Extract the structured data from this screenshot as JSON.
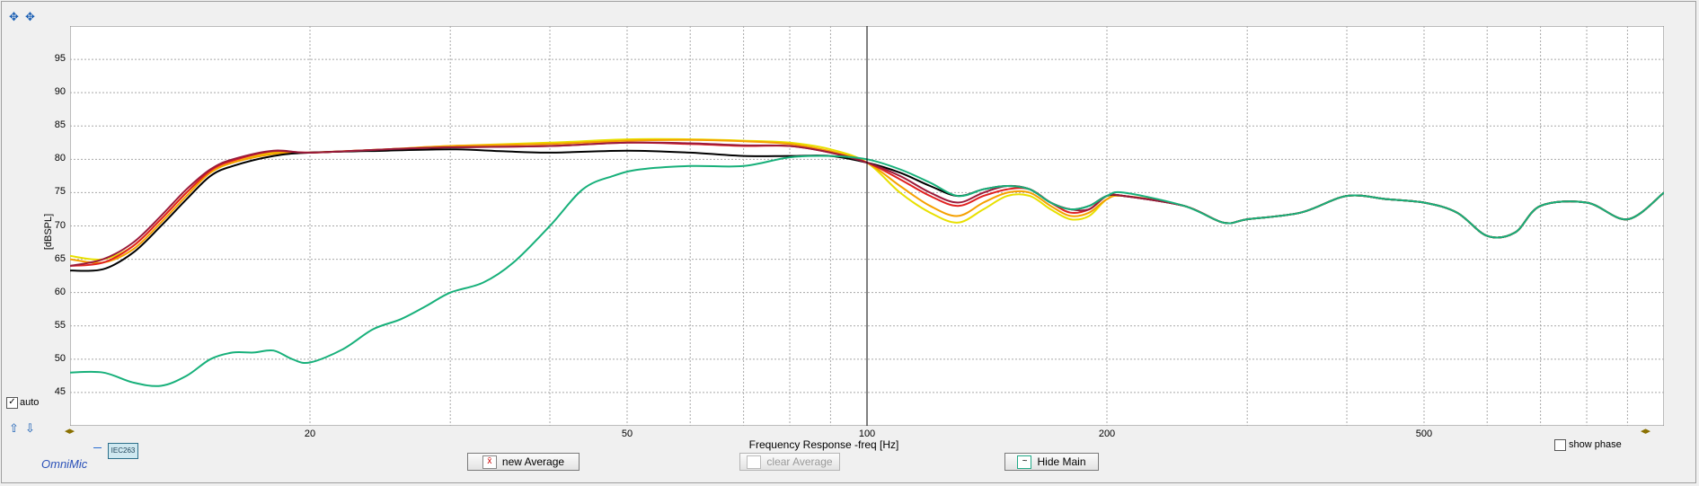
{
  "toolbar": {
    "top_icons": [
      "zoom-fit-icon",
      "zoom-all-icon"
    ],
    "bottom_icons": [
      "scroll-up-icon",
      "scroll-down-icon"
    ],
    "auto_label": "auto",
    "auto_checked": true
  },
  "chart_data": {
    "type": "line",
    "xlabel": "Frequency Response -freq [Hz]",
    "ylabel": "[dBSPL]",
    "xscale": "log",
    "xlim": [
      10,
      1000
    ],
    "ylim": [
      40,
      100
    ],
    "x_ticks": [
      "20",
      "50",
      "100",
      "200",
      "500"
    ],
    "y_ticks": [
      "45",
      "50",
      "55",
      "60",
      "65",
      "70",
      "75",
      "80",
      "85",
      "90",
      "95"
    ],
    "grid": true,
    "cursor_x": 100,
    "series": [
      {
        "color": "#e8e000",
        "points": [
          [
            10,
            65.5
          ],
          [
            11,
            65
          ],
          [
            12,
            67
          ],
          [
            13,
            71
          ],
          [
            14,
            75
          ],
          [
            15,
            78
          ],
          [
            16,
            79.5
          ],
          [
            18,
            81
          ],
          [
            20,
            81
          ],
          [
            25,
            81.5
          ],
          [
            30,
            82
          ],
          [
            40,
            82.5
          ],
          [
            50,
            83
          ],
          [
            60,
            83
          ],
          [
            70,
            82.8
          ],
          [
            80,
            82.5
          ],
          [
            90,
            81.5
          ],
          [
            100,
            79.5
          ],
          [
            110,
            75
          ],
          [
            120,
            72
          ],
          [
            130,
            70.5
          ],
          [
            140,
            72.5
          ],
          [
            150,
            74.5
          ],
          [
            160,
            74.5
          ],
          [
            170,
            72.5
          ],
          [
            180,
            71
          ],
          [
            190,
            71.5
          ],
          [
            200,
            74
          ],
          [
            210,
            74.5
          ],
          [
            250,
            73
          ],
          [
            280,
            70.5
          ],
          [
            300,
            71
          ],
          [
            350,
            72
          ],
          [
            400,
            74.5
          ],
          [
            450,
            74
          ],
          [
            500,
            73.5
          ],
          [
            550,
            72
          ],
          [
            600,
            68.5
          ],
          [
            650,
            69
          ],
          [
            700,
            73
          ],
          [
            800,
            73.5
          ],
          [
            900,
            71
          ],
          [
            1000,
            75
          ]
        ]
      },
      {
        "color": "#f5a000",
        "points": [
          [
            10,
            65
          ],
          [
            11,
            64.5
          ],
          [
            12,
            66.5
          ],
          [
            13,
            70.5
          ],
          [
            14,
            74.5
          ],
          [
            15,
            78
          ],
          [
            16,
            79.5
          ],
          [
            18,
            80.8
          ],
          [
            20,
            81
          ],
          [
            25,
            81.5
          ],
          [
            30,
            82
          ],
          [
            40,
            82.3
          ],
          [
            50,
            82.8
          ],
          [
            60,
            82.9
          ],
          [
            70,
            82.7
          ],
          [
            80,
            82.3
          ],
          [
            90,
            81.2
          ],
          [
            100,
            79.5
          ],
          [
            110,
            76
          ],
          [
            120,
            73
          ],
          [
            130,
            71.5
          ],
          [
            140,
            73.5
          ],
          [
            150,
            75
          ],
          [
            160,
            75
          ],
          [
            170,
            73
          ],
          [
            180,
            71.5
          ],
          [
            190,
            72
          ],
          [
            200,
            74
          ],
          [
            210,
            74.5
          ],
          [
            250,
            73
          ],
          [
            280,
            70.5
          ],
          [
            300,
            71
          ],
          [
            350,
            72
          ],
          [
            400,
            74.5
          ],
          [
            450,
            74
          ],
          [
            500,
            73.5
          ],
          [
            550,
            72
          ],
          [
            600,
            68.5
          ],
          [
            650,
            69
          ],
          [
            700,
            73
          ],
          [
            800,
            73.5
          ],
          [
            900,
            71
          ],
          [
            1000,
            75
          ]
        ]
      },
      {
        "color": "#e02020",
        "points": [
          [
            10,
            64
          ],
          [
            11,
            64.5
          ],
          [
            12,
            67
          ],
          [
            13,
            71
          ],
          [
            14,
            75
          ],
          [
            15,
            78.3
          ],
          [
            16,
            79.8
          ],
          [
            18,
            81.2
          ],
          [
            20,
            81
          ],
          [
            25,
            81.5
          ],
          [
            30,
            81.8
          ],
          [
            40,
            82
          ],
          [
            50,
            82.5
          ],
          [
            60,
            82.3
          ],
          [
            70,
            82
          ],
          [
            80,
            82
          ],
          [
            90,
            81
          ],
          [
            100,
            79.5
          ],
          [
            110,
            77
          ],
          [
            120,
            74.5
          ],
          [
            130,
            73
          ],
          [
            140,
            74.5
          ],
          [
            150,
            75.5
          ],
          [
            160,
            75.5
          ],
          [
            170,
            73.5
          ],
          [
            180,
            72
          ],
          [
            190,
            72.5
          ],
          [
            200,
            74.5
          ],
          [
            210,
            74.5
          ],
          [
            250,
            73
          ],
          [
            280,
            70.5
          ],
          [
            300,
            71
          ],
          [
            350,
            72
          ],
          [
            400,
            74.5
          ],
          [
            450,
            74
          ],
          [
            500,
            73.5
          ],
          [
            550,
            72
          ],
          [
            600,
            68.5
          ],
          [
            650,
            69
          ],
          [
            700,
            73
          ],
          [
            800,
            73.5
          ],
          [
            900,
            71
          ],
          [
            1000,
            75
          ]
        ]
      },
      {
        "color": "#000000",
        "points": [
          [
            10,
            63.3
          ],
          [
            11,
            63.5
          ],
          [
            12,
            66
          ],
          [
            13,
            70
          ],
          [
            14,
            74
          ],
          [
            15,
            77.5
          ],
          [
            16,
            79
          ],
          [
            18,
            80.5
          ],
          [
            20,
            81
          ],
          [
            25,
            81.3
          ],
          [
            30,
            81.5
          ],
          [
            35,
            81.2
          ],
          [
            40,
            81
          ],
          [
            50,
            81.3
          ],
          [
            60,
            81
          ],
          [
            70,
            80.5
          ],
          [
            80,
            80.5
          ],
          [
            90,
            80.5
          ],
          [
            100,
            79.5
          ],
          [
            110,
            78
          ],
          [
            120,
            76
          ],
          [
            130,
            74.5
          ],
          [
            140,
            75.5
          ],
          [
            150,
            76
          ],
          [
            160,
            75.5
          ],
          [
            170,
            73.5
          ],
          [
            180,
            72.5
          ],
          [
            190,
            73
          ],
          [
            200,
            74.5
          ],
          [
            210,
            74.5
          ],
          [
            250,
            73
          ],
          [
            280,
            70.5
          ],
          [
            300,
            71
          ],
          [
            350,
            72
          ],
          [
            400,
            74.5
          ],
          [
            450,
            74
          ],
          [
            500,
            73.5
          ],
          [
            550,
            72
          ],
          [
            600,
            68.5
          ],
          [
            650,
            69
          ],
          [
            700,
            73
          ],
          [
            800,
            73.5
          ],
          [
            900,
            71
          ],
          [
            1000,
            75
          ]
        ]
      },
      {
        "color": "#9b1a3a",
        "points": [
          [
            10,
            64
          ],
          [
            11,
            65
          ],
          [
            12,
            67.5
          ],
          [
            13,
            71.5
          ],
          [
            14,
            75.5
          ],
          [
            15,
            78.5
          ],
          [
            16,
            80
          ],
          [
            18,
            81.3
          ],
          [
            20,
            81
          ],
          [
            25,
            81.5
          ],
          [
            30,
            81.8
          ],
          [
            40,
            82
          ],
          [
            50,
            82.5
          ],
          [
            60,
            82.4
          ],
          [
            70,
            82.1
          ],
          [
            80,
            82
          ],
          [
            90,
            81
          ],
          [
            100,
            79.5
          ],
          [
            110,
            77.5
          ],
          [
            120,
            75
          ],
          [
            130,
            73.5
          ],
          [
            140,
            75
          ],
          [
            150,
            76
          ],
          [
            160,
            75.5
          ],
          [
            170,
            73.5
          ],
          [
            180,
            72.5
          ],
          [
            190,
            72.5
          ],
          [
            200,
            74.5
          ],
          [
            210,
            74.5
          ],
          [
            250,
            73
          ],
          [
            280,
            70.5
          ],
          [
            300,
            71
          ],
          [
            350,
            72
          ],
          [
            400,
            74.5
          ],
          [
            450,
            74
          ],
          [
            500,
            73.5
          ],
          [
            550,
            72
          ],
          [
            600,
            68.5
          ],
          [
            650,
            69
          ],
          [
            700,
            73
          ],
          [
            800,
            73.5
          ],
          [
            900,
            71
          ],
          [
            1000,
            75
          ]
        ]
      },
      {
        "color": "#17b07a",
        "points": [
          [
            10,
            48
          ],
          [
            11,
            48
          ],
          [
            12,
            46.5
          ],
          [
            13,
            46
          ],
          [
            14,
            47.5
          ],
          [
            15,
            50
          ],
          [
            16,
            51
          ],
          [
            17,
            51
          ],
          [
            18,
            51.3
          ],
          [
            19,
            50
          ],
          [
            20,
            49.5
          ],
          [
            22,
            51.5
          ],
          [
            24,
            54.5
          ],
          [
            26,
            56
          ],
          [
            28,
            58
          ],
          [
            30,
            60
          ],
          [
            33,
            61.5
          ],
          [
            36,
            64.5
          ],
          [
            40,
            70
          ],
          [
            44,
            75.5
          ],
          [
            48,
            77.5
          ],
          [
            52,
            78.5
          ],
          [
            60,
            79
          ],
          [
            70,
            79
          ],
          [
            80,
            80.3
          ],
          [
            90,
            80.5
          ],
          [
            100,
            80
          ],
          [
            110,
            78.5
          ],
          [
            120,
            76.5
          ],
          [
            130,
            74.5
          ],
          [
            140,
            75.5
          ],
          [
            150,
            76
          ],
          [
            160,
            75.5
          ],
          [
            170,
            73.5
          ],
          [
            180,
            72.5
          ],
          [
            190,
            73
          ],
          [
            200,
            74.5
          ],
          [
            210,
            75
          ],
          [
            250,
            73
          ],
          [
            280,
            70.5
          ],
          [
            300,
            71
          ],
          [
            350,
            72
          ],
          [
            400,
            74.5
          ],
          [
            450,
            74
          ],
          [
            500,
            73.5
          ],
          [
            550,
            72
          ],
          [
            600,
            68.5
          ],
          [
            650,
            69
          ],
          [
            700,
            73
          ],
          [
            800,
            73.5
          ],
          [
            900,
            71
          ],
          [
            1000,
            75
          ]
        ]
      }
    ]
  },
  "controls": {
    "new_average": "new Average",
    "clear_average": "clear Average",
    "hide_main": "Hide Main",
    "show_phase": "show phase",
    "show_phase_checked": false,
    "mic_tag": "IEC263",
    "brand": "OmniMic"
  }
}
